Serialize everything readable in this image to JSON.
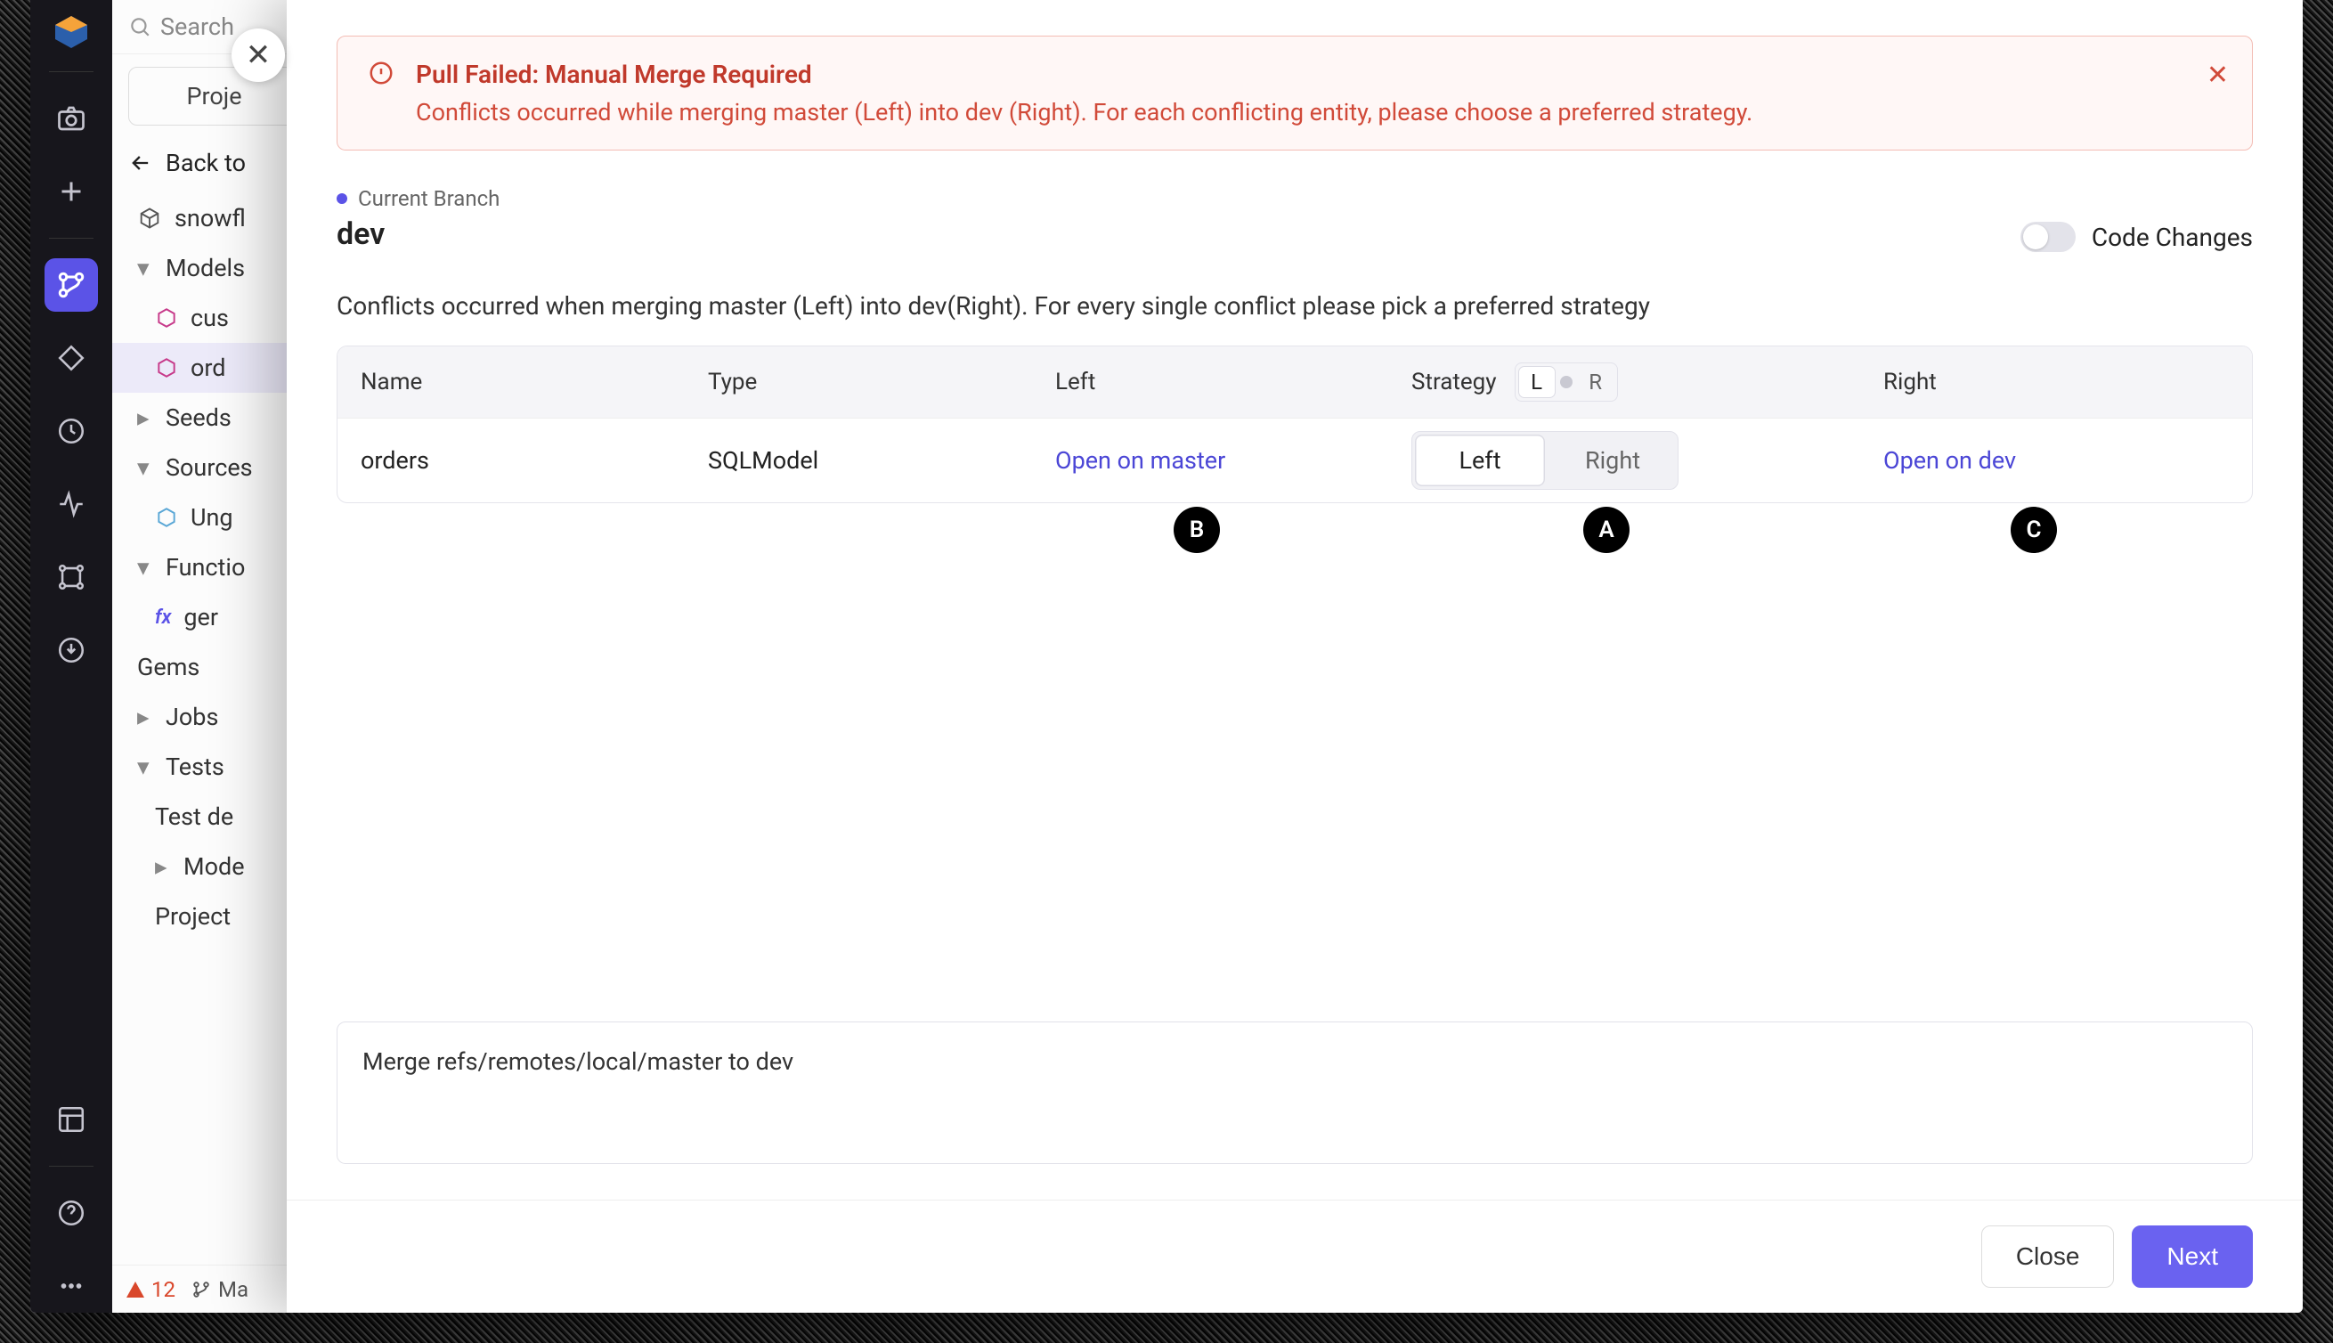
{
  "rail": {
    "icons": [
      "logo",
      "camera",
      "plus",
      "branches",
      "diamond",
      "clock",
      "activity",
      "graph",
      "download",
      "layout",
      "help",
      "more"
    ]
  },
  "tree": {
    "search_placeholder": "Search",
    "project_button": "Proje",
    "back_label": "Back to",
    "root_label": "snowfl",
    "models_label": "Models",
    "model_cus": "cus",
    "model_ord": "ord",
    "seeds_label": "Seeds",
    "sources_label": "Sources",
    "ungrouped_label": "Ung",
    "functions_label": "Functio",
    "function_ger": "ger",
    "gems_label": "Gems",
    "jobs_label": "Jobs",
    "tests_label": "Tests",
    "test_de": "Test de",
    "mode_label": "Mode",
    "project_label": "Project",
    "footer_warn_count": "12",
    "footer_branch": "Ma"
  },
  "modal": {
    "close_glyph": "✕",
    "alert": {
      "title": "Pull Failed: Manual Merge Required",
      "desc": "Conflicts occurred while merging master (Left) into dev (Right). For each conflicting entity, please choose a preferred strategy.",
      "dismiss": "✕"
    },
    "branch_label": "Current Branch",
    "branch_name": "dev",
    "code_changes_label": "Code Changes",
    "subheading": "Conflicts occurred when merging master (Left) into dev(Right). For every single conflict please pick a preferred strategy",
    "columns": {
      "name": "Name",
      "type": "Type",
      "left": "Left",
      "strategy": "Strategy",
      "right": "Right",
      "L": "L",
      "R": "R"
    },
    "row": {
      "name": "orders",
      "type": "SQLModel",
      "open_left": "Open on master",
      "open_right": "Open on dev",
      "opt_left": "Left",
      "opt_right": "Right"
    },
    "annotations": {
      "A": "A",
      "B": "B",
      "C": "C"
    },
    "commit_message": "Merge refs/remotes/local/master to dev",
    "close_button": "Close",
    "next_button": "Next"
  }
}
